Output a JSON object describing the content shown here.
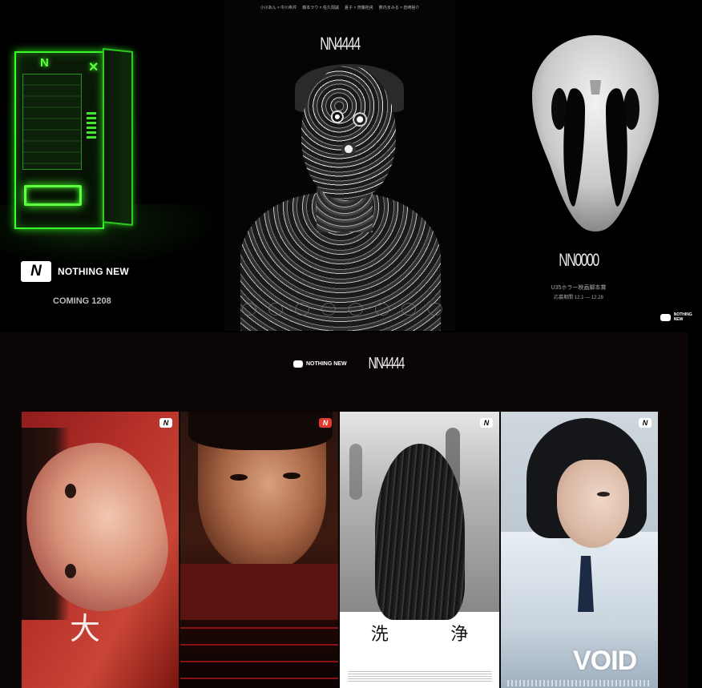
{
  "brand": {
    "logo_letter": "N",
    "name": "NOTHING NEW"
  },
  "vending_machine_panel": {
    "coming_text": "COMING 1208",
    "glow_color": "#39ff2a"
  },
  "face_poster": {
    "title": "NN4444",
    "credits": [
      "小川あん × 中川希芹",
      "藤本ラウ × 佐久間誠",
      "夏子 × 齊藤拓央",
      "數内まみる × 岩崎裕介"
    ]
  },
  "skull_poster": {
    "title": "NN0000",
    "subtitle": "U35ホラー映画脚本賞",
    "dates": "応募期間 12.1 — 12.28"
  },
  "banner": {
    "title": "NN4444",
    "posters": [
      {
        "glyph": "大",
        "palette": "red"
      },
      {
        "palette": "dark-red"
      },
      {
        "title_chars": [
          "洗",
          "浄"
        ],
        "palette": "monochrome"
      },
      {
        "title": "VOID",
        "palette": "blue-grey"
      }
    ]
  }
}
